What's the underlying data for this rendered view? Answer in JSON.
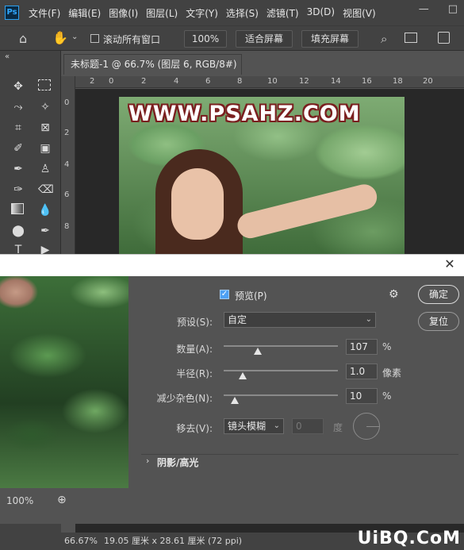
{
  "app": {
    "logo": "Ps"
  },
  "menu": [
    "文件(F)",
    "编辑(E)",
    "图像(I)",
    "图层(L)",
    "文字(Y)",
    "选择(S)",
    "滤镜(T)",
    "3D(D)",
    "视图(V)"
  ],
  "options_bar": {
    "scroll_all_label": "滚动所有窗口",
    "zoom_value": "100%",
    "fit_screen": "适合屏幕",
    "fill_screen": "填充屏幕"
  },
  "document": {
    "tab_title": "未标题-1 @ 66.7% (图层 6, RGB/8#) *",
    "ruler_top": [
      "2",
      "0",
      "2",
      "4",
      "6",
      "8",
      "10",
      "12",
      "14",
      "16",
      "18",
      "20"
    ],
    "ruler_left": [
      "0",
      "2",
      "4",
      "6",
      "8"
    ]
  },
  "image": {
    "watermark": "WWW.PSAHZ.COM"
  },
  "dialog": {
    "preview_label": "预览(P)",
    "preview_checked": true,
    "preset_label": "预设(S):",
    "preset_value": "自定",
    "strength_label": "数量(A):",
    "strength_value": "107",
    "strength_unit": "%",
    "strength_level": 0.3,
    "radius_label": "半径(R):",
    "radius_value": "1.0",
    "radius_unit": "像素",
    "radius_level": 0.17,
    "reduce_noise_label": "减少杂色(N):",
    "reduce_noise_value": "10",
    "reduce_noise_unit": "%",
    "reduce_noise_level": 0.1,
    "remove_label": "移去(V):",
    "remove_value": "镜头模糊",
    "angle_value": "0",
    "angle_unit": "度",
    "section_title": "阴影/高光",
    "ok": "确定",
    "reset": "复位",
    "preview_zoom": "100%"
  },
  "status": {
    "zoom": "66.67%",
    "doc_size": "19.05 厘米 x 28.61 厘米 (72 ppi)"
  },
  "brand": "UiBQ.CoM"
}
